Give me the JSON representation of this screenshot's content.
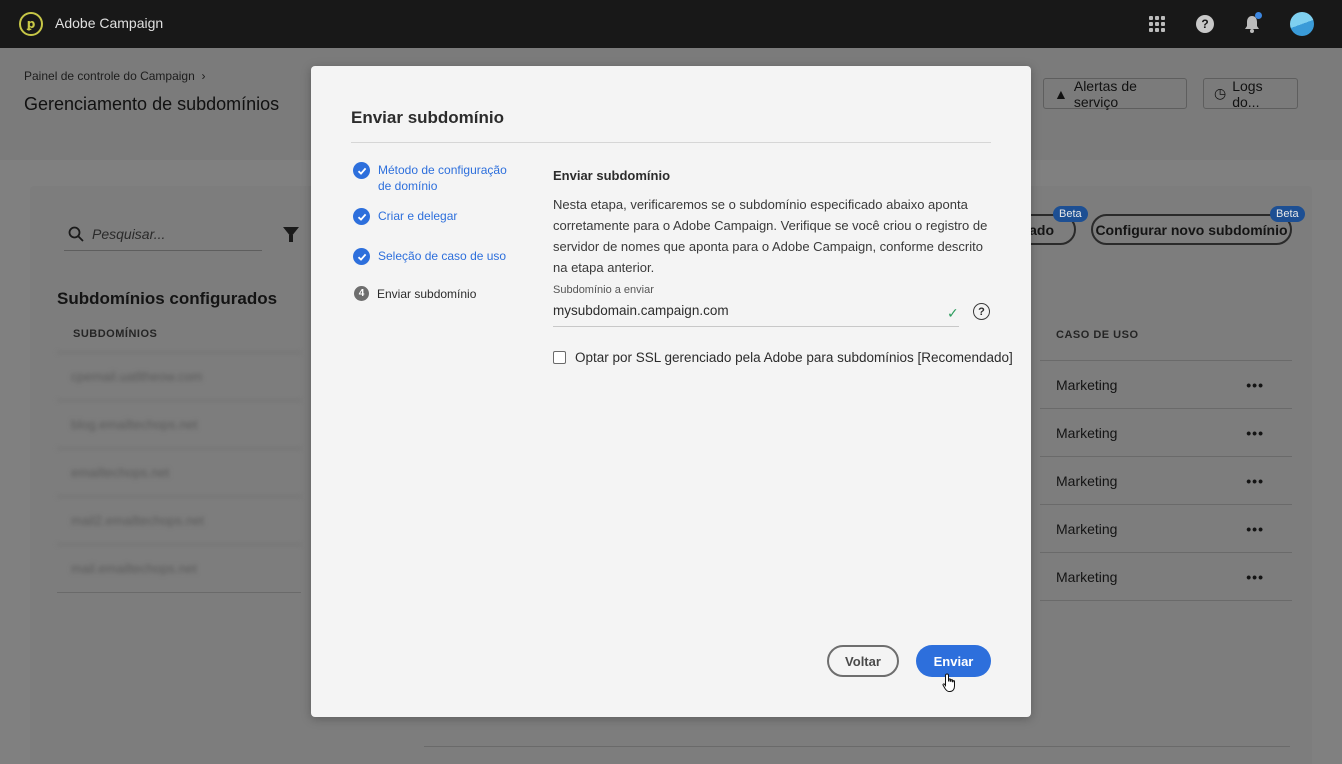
{
  "topbar": {
    "app_title": "Adobe Campaign",
    "icons": [
      "apps-grid-icon",
      "help-icon",
      "notification-bell-icon",
      "user-avatar"
    ]
  },
  "page": {
    "breadcrumb": "Painel de controle do Campaign",
    "title": "Gerenciamento de subdomínios",
    "header_buttons": {
      "alerts": "Alertas de serviço",
      "logs": "Logs do..."
    },
    "search_placeholder": "Pesquisar...",
    "buttons": {
      "partial_label": "ado",
      "configure_new": "Configurar novo subdomínio",
      "beta_badge": "Beta"
    },
    "section_title": "Subdomínios configurados",
    "columns": {
      "subdomains": "SUBDOMÍNIOS",
      "use_case": "CASO DE USO"
    },
    "subdomain_rows": [
      "cpemail.uatltheow.com",
      "blog.emailtechops.net",
      "emailtechops.net",
      "mail2.emailtechops.net",
      "mail.emailtechops.net"
    ],
    "use_case_rows": [
      "Marketing",
      "Marketing",
      "Marketing",
      "Marketing",
      "Marketing"
    ],
    "row_menu": "•••"
  },
  "modal": {
    "title": "Enviar subdomínio",
    "steps": [
      {
        "label": "Método de configuração de domínio",
        "status": "done"
      },
      {
        "label": "Criar e delegar",
        "status": "done"
      },
      {
        "label": "Seleção de caso de uso",
        "status": "done"
      },
      {
        "number": "4",
        "label": "Enviar subdomínio",
        "status": "current"
      }
    ],
    "content_title": "Enviar subdomínio",
    "description": "Nesta etapa, verificaremos se o subdomínio especificado abaixo aponta corretamente para o  Adobe Campaign. Verifique se você criou o registro de servidor de nomes que aponta para o  Adobe Campaign, conforme descrito na etapa anterior.",
    "field_label": "Subdomínio a enviar",
    "field_value": "mysubdomain.campaign.com",
    "checkbox_label": "Optar por SSL gerenciado pela Adobe para subdomínios [Recomendado]",
    "checkbox_checked": false,
    "back_button": "Voltar",
    "submit_button": "Enviar",
    "accent_color": "#2d6fdc"
  }
}
